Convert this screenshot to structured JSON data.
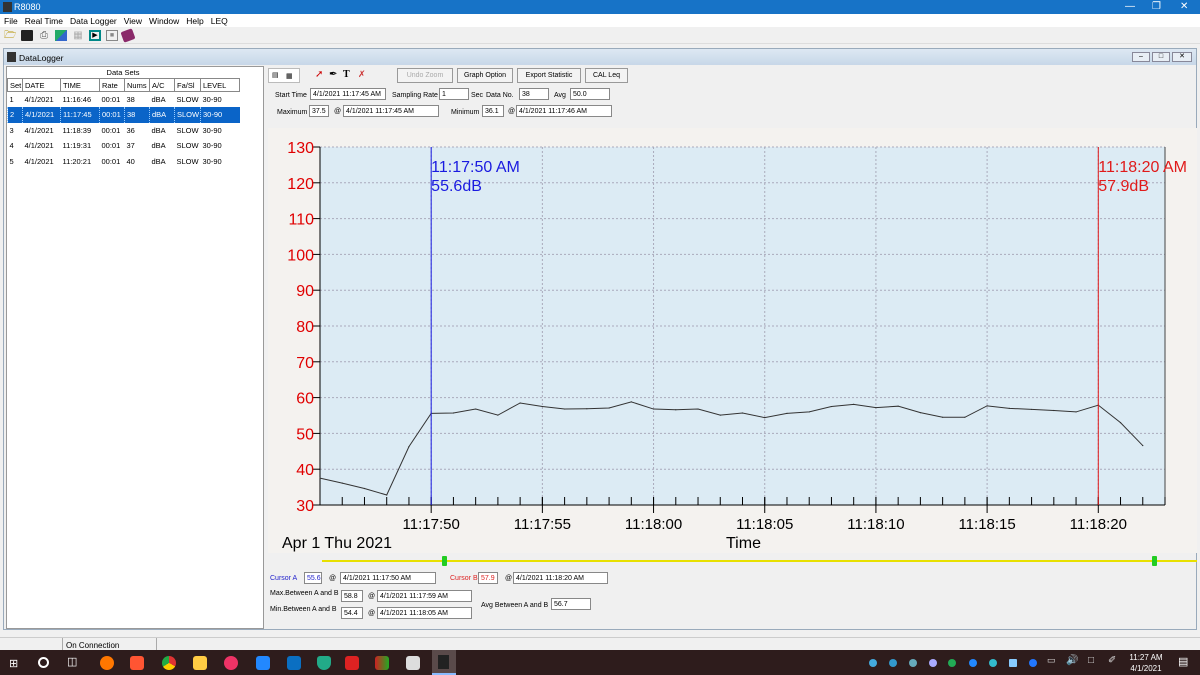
{
  "window": {
    "title": "R8080"
  },
  "menu": [
    "File",
    "Real Time",
    "Data Logger",
    "View",
    "Window",
    "Help",
    "LEQ"
  ],
  "toolbar_icons": [
    "open-folder-icon",
    "save-icon",
    "print-icon",
    "export-icon",
    "grid-icon",
    "play-icon",
    "stop-icon",
    "book-icon"
  ],
  "child": {
    "title": "DataLogger"
  },
  "datasets": {
    "title": "Data Sets",
    "columns": [
      "Set",
      "DATE",
      "TIME",
      "Rate",
      "Nums",
      "A/C",
      "Fa/Sl",
      "LEVEL"
    ],
    "rows": [
      [
        "1",
        "4/1/2021",
        "11:16:46",
        "00:01",
        "38",
        "dBA",
        "SLOW",
        "30-90"
      ],
      [
        "2",
        "4/1/2021",
        "11:17:45",
        "00:01",
        "38",
        "dBA",
        "SLOW",
        "30-90"
      ],
      [
        "3",
        "4/1/2021",
        "11:18:39",
        "00:01",
        "36",
        "dBA",
        "SLOW",
        "30-90"
      ],
      [
        "4",
        "4/1/2021",
        "11:19:31",
        "00:01",
        "37",
        "dBA",
        "SLOW",
        "30-90"
      ],
      [
        "5",
        "4/1/2021",
        "11:20:21",
        "00:01",
        "40",
        "dBA",
        "SLOW",
        "30-90"
      ]
    ],
    "selected_index": 1
  },
  "graph_toolbar": {
    "undo_zoom": "Undo Zoom",
    "graph_option": "Graph Option",
    "export_statistic": "Export Statistic",
    "cal_leq": "CAL Leq"
  },
  "info": {
    "start_time_label": "Start Time",
    "start_time": "4/1/2021 11:17:45 AM",
    "sampling_rate_label": "Sampling Rate",
    "sampling_rate": "1",
    "sec_label": "Sec",
    "data_no_label": "Data No.",
    "data_no": "38",
    "avg_label": "Avg",
    "avg": "50.0",
    "maximum_label": "Maximum",
    "maximum": "37.5",
    "at": "@",
    "maximum_time": "4/1/2021 11:17:45 AM",
    "minimum_label": "Minimum",
    "minimum": "36.1",
    "minimum_time": "4/1/2021 11:17:46 AM"
  },
  "chart_data": {
    "type": "line",
    "date_label": "Apr 1 Thu 2021",
    "xlabel": "Time",
    "ylim": [
      30,
      130
    ],
    "yticks": [
      30,
      40,
      50,
      60,
      70,
      80,
      90,
      100,
      110,
      120,
      130
    ],
    "xtick_labels": [
      "11:17:50",
      "11:17:55",
      "11:18:00",
      "11:18:05",
      "11:18:10",
      "11:18:15",
      "11:18:20"
    ],
    "x_start": "11:17:45",
    "x_end": "11:18:23",
    "grid": true,
    "series": [
      {
        "x_start": "11:17:45",
        "interval_sec": 1,
        "values": [
          37.5,
          36.1,
          34.6,
          32.8,
          46.3,
          55.6,
          55.7,
          56.8,
          55.1,
          58.5,
          57.5,
          56.8,
          56.9,
          57.1,
          58.8,
          56.8,
          56.6,
          56.8,
          55.1,
          55.7,
          54.4,
          55.6,
          56.0,
          57.5,
          58.1,
          57.2,
          57.6,
          55.8,
          54.5,
          54.5,
          57.7,
          57.0,
          56.7,
          56.4,
          56.0,
          57.9,
          53.0,
          46.6
        ]
      }
    ],
    "cursor_a": {
      "time": "11:17:50 AM",
      "value": "55.6dB",
      "color": "#1a1ae0"
    },
    "cursor_b": {
      "time": "11:18:20 AM",
      "value": "57.9dB",
      "color": "#e01a1a"
    },
    "ytick_color": "#e00000"
  },
  "cursors": {
    "a_label": "Cursor A",
    "a_value": "55.6",
    "a_time": "4/1/2021 11:17:50 AM",
    "b_label": "Cursor B",
    "b_value": "57.9",
    "b_time": "4/1/2021 11:18:20 AM",
    "max_label": "Max.Between A and B",
    "max_value": "58.8",
    "max_time": "4/1/2021 11:17:59 AM",
    "min_label": "Min.Between A and B",
    "min_value": "54.4",
    "min_time": "4/1/2021 11:18:05 AM",
    "avg_label": "Avg Between A and B",
    "avg_value": "56.7"
  },
  "status": {
    "connection": "On Connection"
  },
  "taskbar": {
    "time": "11:27 AM",
    "date": "4/1/2021"
  }
}
